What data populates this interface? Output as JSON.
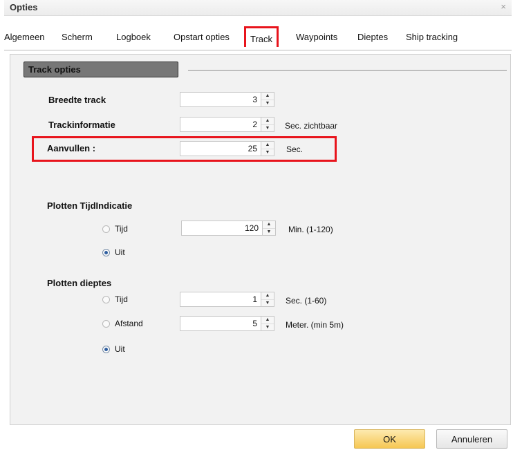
{
  "window": {
    "title": "Opties",
    "close_glyph": "×"
  },
  "tabs": [
    {
      "label": "Algemeen",
      "active": false
    },
    {
      "label": "Scherm",
      "active": false
    },
    {
      "label": "Logboek",
      "active": false
    },
    {
      "label": "Opstart opties",
      "active": false
    },
    {
      "label": "Track",
      "active": true
    },
    {
      "label": "Waypoints",
      "active": false
    },
    {
      "label": "Dieptes",
      "active": false
    },
    {
      "label": "Ship tracking",
      "active": false
    }
  ],
  "group": {
    "title": "Track opties"
  },
  "fields": {
    "breedte": {
      "label": "Breedte track",
      "value": "3"
    },
    "trackinfo": {
      "label": "Trackinformatie",
      "value": "2",
      "unit": "Sec. zichtbaar"
    },
    "aanvullen": {
      "label": "Aanvullen :",
      "value": "25",
      "unit": "Sec."
    }
  },
  "plotten_tijd": {
    "title": "Plotten TijdIndicatie",
    "tijd_label": "Tijd",
    "tijd_value": "120",
    "tijd_unit": "Min. (1-120)",
    "uit_label": "Uit",
    "selected": "Uit"
  },
  "plotten_dieptes": {
    "title": "Plotten dieptes",
    "tijd_label": "Tijd",
    "tijd_value": "1",
    "tijd_unit": "Sec. (1-60)",
    "afstand_label": "Afstand",
    "afstand_value": "5",
    "afstand_unit": "Meter. (min 5m)",
    "uit_label": "Uit",
    "selected": "Uit"
  },
  "buttons": {
    "ok": "OK",
    "cancel": "Annuleren"
  },
  "icons": {
    "spin_up": "▲",
    "spin_down": "▼"
  },
  "colors": {
    "highlight": "#e8141c",
    "ok_button": "#f6c753",
    "group_header": "#777777"
  }
}
